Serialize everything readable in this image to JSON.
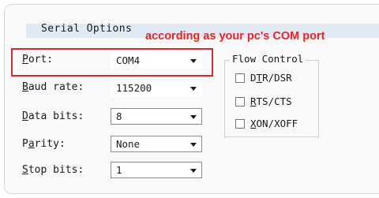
{
  "group_title": "Serial Options",
  "annotation": "according as your pc's COM port",
  "fields": [
    {
      "label": "Port:",
      "value": "COM4"
    },
    {
      "label": "Baud rate:",
      "value": "115200"
    },
    {
      "label": "Data bits:",
      "value": "8"
    },
    {
      "label": "Parity:",
      "value": "None"
    },
    {
      "label": "Stop bits:",
      "value": "1"
    }
  ],
  "flow_control": {
    "title": "Flow Control",
    "options": [
      {
        "label": "DTR/DSR",
        "checked": false
      },
      {
        "label": "RTS/CTS",
        "checked": false
      },
      {
        "label": "XON/XOFF",
        "checked": false
      }
    ]
  },
  "colors": {
    "annotation": "#e52424",
    "highlight": "#d22b2b",
    "header": "#e1e9f4"
  }
}
